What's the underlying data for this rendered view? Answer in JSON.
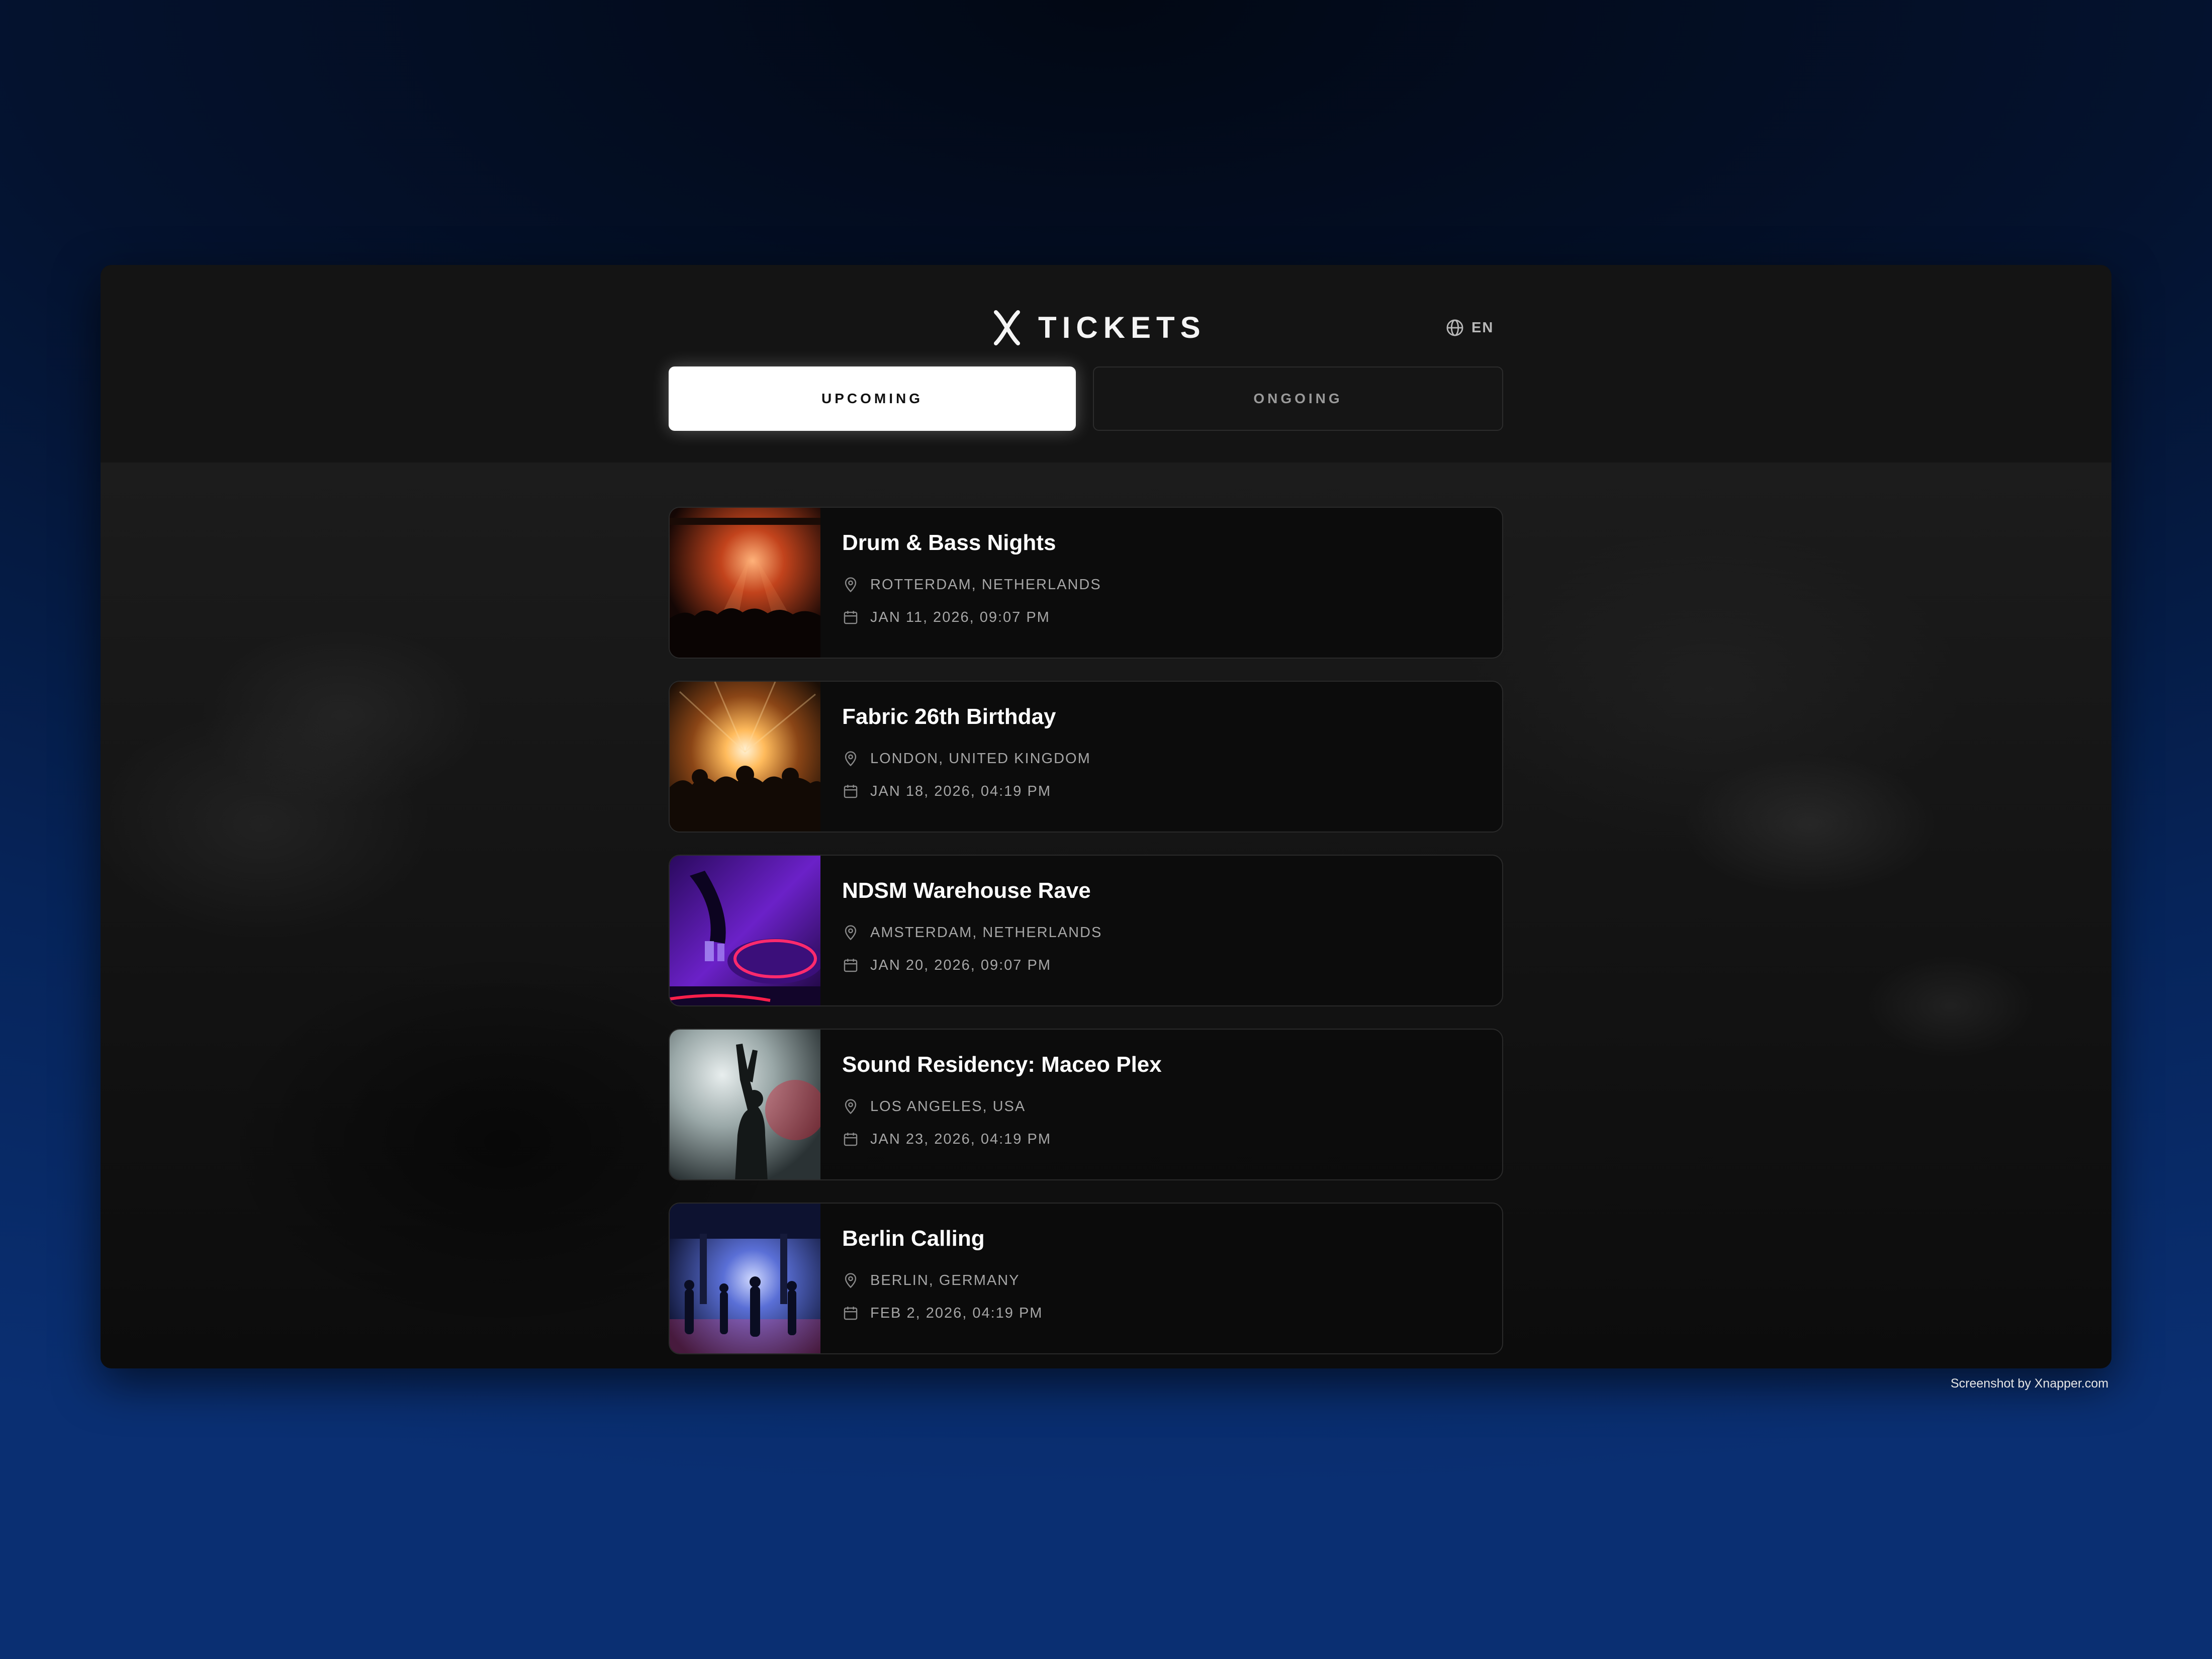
{
  "app": {
    "title": "TICKETS",
    "language": "EN"
  },
  "tabs": [
    {
      "label": "UPCOMING",
      "active": true
    },
    {
      "label": "ONGOING",
      "active": false
    }
  ],
  "events": [
    {
      "title": "Drum & Bass Nights",
      "location": "ROTTERDAM, NETHERLANDS",
      "date": "JAN 11, 2026, 09:07 PM",
      "image": "concert-stage-orange-lights"
    },
    {
      "title": "Fabric 26th Birthday",
      "location": "LONDON, UNITED KINGDOM",
      "date": "JAN 18, 2026, 04:19 PM",
      "image": "crowd-bright-stage-lights"
    },
    {
      "title": "NDSM Warehouse Rave",
      "location": "AMSTERDAM, NETHERLANDS",
      "date": "JAN 20, 2026, 09:07 PM",
      "image": "dj-turntable-purple"
    },
    {
      "title": "Sound Residency: Maceo Plex",
      "location": "LOS ANGELES, USA",
      "date": "JAN 23, 2026, 04:19 PM",
      "image": "raver-hands-up-smoke"
    },
    {
      "title": "Berlin Calling",
      "location": "BERLIN, GERMANY",
      "date": "FEB 2, 2026, 04:19 PM",
      "image": "warehouse-crowd-blue"
    }
  ],
  "footer": {
    "credit": "Screenshot by Xnapper.com"
  },
  "colors": {
    "card_bg": "#0c0c0c",
    "header_bg": "#141414",
    "active_tab": "#ffffff",
    "text_muted": "#a6a6a6"
  }
}
